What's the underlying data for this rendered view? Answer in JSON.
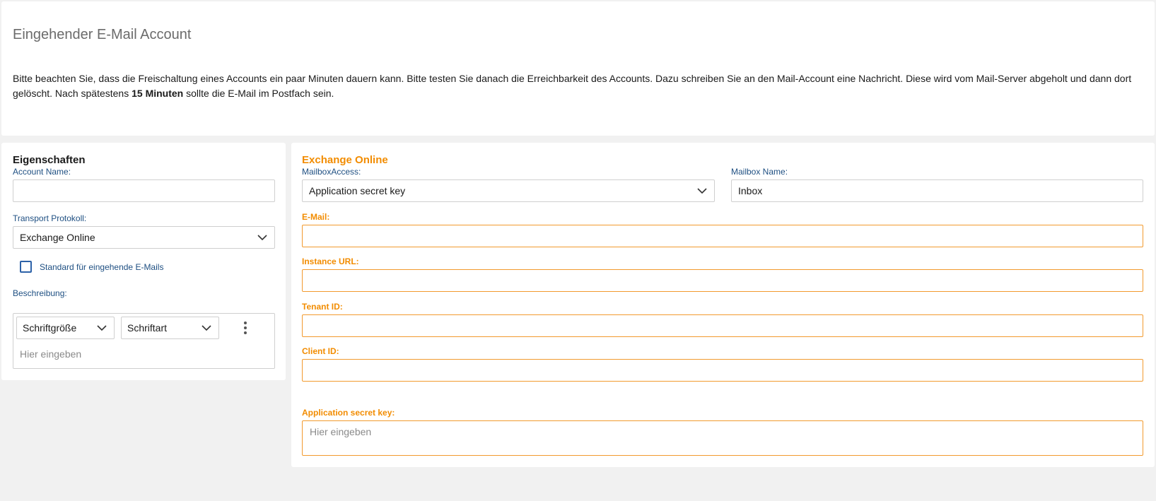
{
  "info": {
    "title": "Eingehender E-Mail Account",
    "text_before_bold": "Bitte beachten Sie, dass die Freischaltung eines Accounts ein paar Minuten dauern kann. Bitte testen Sie danach die Erreichbarkeit des Accounts. Dazu schreiben Sie an den Mail-Account eine Nachricht. Diese wird vom Mail-Server abgeholt und dann dort gelöscht. Nach spätestens ",
    "text_bold": "15 Minuten",
    "text_after_bold": " sollte die E-Mail im Postfach sein."
  },
  "properties": {
    "title": "Eigenschaften",
    "account_name_label": "Account Name:",
    "account_name_value": "",
    "transport_label": "Transport Protokoll:",
    "transport_value": "Exchange Online",
    "default_checkbox_label": "Standard für eingehende E-Mails",
    "default_checked": false,
    "description_label": "Beschreibung:",
    "font_size_select": "Schriftgröße",
    "font_family_select": "Schriftart",
    "description_placeholder": "Hier eingeben"
  },
  "exchange": {
    "title": "Exchange Online",
    "mailbox_access_label": "MailboxAccess:",
    "mailbox_access_value": "Application secret key",
    "mailbox_name_label": "Mailbox Name:",
    "mailbox_name_value": "Inbox",
    "email_label": "E-Mail:",
    "email_value": "",
    "instance_url_label": "Instance URL:",
    "instance_url_value": "",
    "tenant_id_label": "Tenant ID:",
    "tenant_id_value": "",
    "client_id_label": "Client ID:",
    "client_id_value": "",
    "secret_key_label": "Application secret key:",
    "secret_key_placeholder": "Hier eingeben"
  },
  "colors": {
    "accent_orange": "#f28c00",
    "label_blue": "#1e4f82",
    "checkbox_blue": "#2d62a8",
    "background": "#f1f1f1"
  }
}
